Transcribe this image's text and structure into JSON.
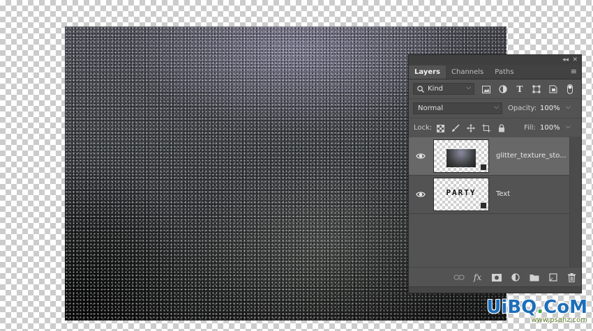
{
  "canvas": {
    "content": "glitter texture image"
  },
  "panel": {
    "topbar": {
      "collapse_glyph": "◂◂",
      "close_glyph": "✕"
    },
    "tabs": [
      {
        "label": "Layers",
        "active": true
      },
      {
        "label": "Channels",
        "active": false
      },
      {
        "label": "Paths",
        "active": false
      }
    ],
    "filter": {
      "kind_label": "Kind",
      "icons": [
        "image-filter-icon",
        "adjustment-filter-icon",
        "type-filter-icon",
        "shape-filter-icon",
        "smart-object-filter-icon",
        "filter-toggle-icon"
      ]
    },
    "blend": {
      "mode": "Normal",
      "opacity_label": "Opacity:",
      "opacity_value": "100%"
    },
    "lock": {
      "label": "Lock:",
      "fill_label": "Fill:",
      "fill_value": "100%"
    },
    "layers": [
      {
        "name": "glitter_texture_sto...",
        "selected": true,
        "type": "smart-object"
      },
      {
        "name": "Text",
        "selected": false,
        "type": "smart-object",
        "thumb_text": "PARTY"
      }
    ],
    "bottom_icons": [
      "link-layers-icon",
      "fx-icon",
      "layer-mask-icon",
      "adjustment-layer-icon",
      "group-folder-icon",
      "new-layer-icon",
      "trash-icon"
    ]
  },
  "watermark": {
    "logo_a": "UiBQ",
    "logo_b": ".",
    "logo_c": "CoM",
    "url": "www.psahz.com"
  },
  "colors": {
    "accent": "#1d6eb9",
    "panel_bg": "#535353",
    "selected_layer": "#686868"
  }
}
